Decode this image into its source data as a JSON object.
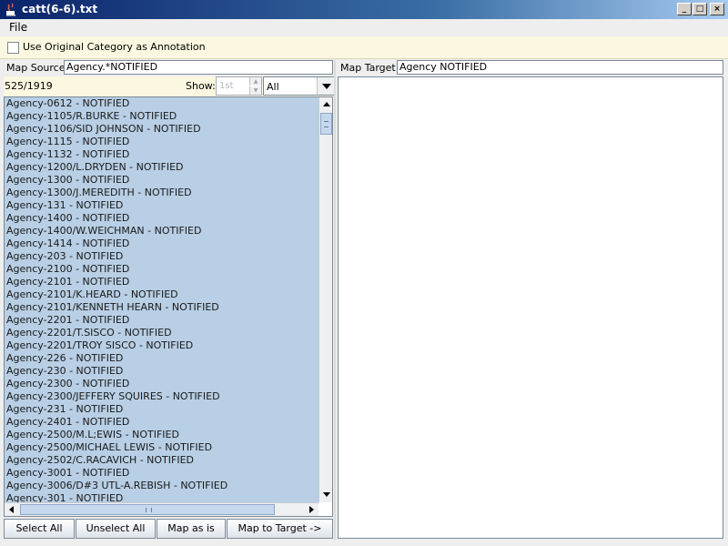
{
  "window": {
    "title": "catt(6-6).txt",
    "icon": "java-cup-icon"
  },
  "menu": {
    "items": [
      "File"
    ]
  },
  "options": {
    "use_original_label": "Use Original Category as Annotation",
    "checked": false
  },
  "source": {
    "label": "Map Source:",
    "value": "Agency.*NOTIFIED"
  },
  "target": {
    "label": "Map Target:",
    "value": "Agency NOTIFIED"
  },
  "list_info": {
    "count": "525/1919",
    "show_label": "Show:",
    "spinner_value": "1st",
    "show_option": "All"
  },
  "items": [
    "Agency-0612 - NOTIFIED",
    "Agency-1105/R.BURKE - NOTIFIED",
    "Agency-1106/SID JOHNSON - NOTIFIED",
    "Agency-1115 - NOTIFIED",
    "Agency-1132 - NOTIFIED",
    "Agency-1200/L.DRYDEN - NOTIFIED",
    "Agency-1300 - NOTIFIED",
    "Agency-1300/J.MEREDITH - NOTIFIED",
    "Agency-131 - NOTIFIED",
    "Agency-1400 - NOTIFIED",
    "Agency-1400/W.WEICHMAN - NOTIFIED",
    "Agency-1414 - NOTIFIED",
    "Agency-203 - NOTIFIED",
    "Agency-2100 - NOTIFIED",
    "Agency-2101 - NOTIFIED",
    "Agency-2101/K.HEARD - NOTIFIED",
    "Agency-2101/KENNETH HEARN - NOTIFIED",
    "Agency-2201 - NOTIFIED",
    "Agency-2201/T.SISCO - NOTIFIED",
    "Agency-2201/TROY SISCO - NOTIFIED",
    "Agency-226 - NOTIFIED",
    "Agency-230 - NOTIFIED",
    "Agency-2300 - NOTIFIED",
    "Agency-2300/JEFFERY SQUIRES - NOTIFIED",
    "Agency-231 - NOTIFIED",
    "Agency-2401 - NOTIFIED",
    "Agency-2500/M.L;EWIS - NOTIFIED",
    "Agency-2500/MICHAEL LEWIS - NOTIFIED",
    "Agency-2502/C.RACAVICH - NOTIFIED",
    "Agency-3001 - NOTIFIED",
    "Agency-3006/D#3 UTL-A.REBISH - NOTIFIED",
    "Agency-301 - NOTIFIED"
  ],
  "buttons": {
    "select_all": "Select All",
    "unselect_all": "Unselect All",
    "map_as_is": "Map as is",
    "map_to_target": "Map to Target ->"
  },
  "colors": {
    "selection": "#b8cfe5",
    "panel_bg": "#fbf7e0",
    "title_start": "#0a246a"
  }
}
